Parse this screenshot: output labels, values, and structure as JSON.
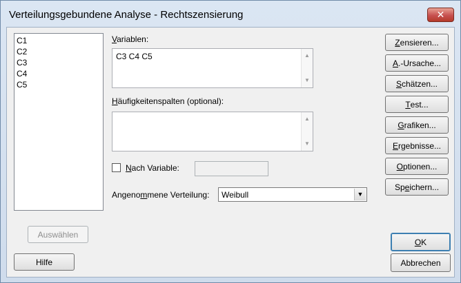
{
  "window": {
    "title": "Verteilungsgebundene Analyse - Rechtszensierung",
    "close_icon": "close-icon"
  },
  "columns_list": {
    "items": [
      "C1",
      "C2",
      "C3",
      "C4",
      "C5"
    ]
  },
  "variables": {
    "label_pre": "",
    "label_u": "V",
    "label_post": "ariablen:",
    "value": "C3 C4 C5"
  },
  "frequency": {
    "label_pre": "",
    "label_u": "H",
    "label_post": "äufigkeitenspalten (optional):",
    "value": ""
  },
  "by_variable": {
    "label_pre": "",
    "label_u": "N",
    "label_post": "ach Variable:",
    "checked": false,
    "value": ""
  },
  "distribution": {
    "label_pre": "Angeno",
    "label_u": "m",
    "label_post": "mene Verteilung:",
    "selected": "Weibull"
  },
  "buttons": {
    "select": "Auswählen",
    "help": "Hilfe",
    "ok_u": "O",
    "ok_post": "K",
    "cancel": "Abbrechen",
    "censor_u": "Z",
    "censor_post": "ensieren...",
    "cause_u": "A",
    "cause_post": ".-Ursache...",
    "estimate_u": "S",
    "estimate_post": "chätzen...",
    "test_pre": "",
    "test_u": "T",
    "test_post": "est...",
    "graphs_u": "G",
    "graphs_post": "rafiken...",
    "results_u": "E",
    "results_post": "rgebnisse...",
    "options_u": "O",
    "options_post": "ptionen...",
    "store_pre": "Sp",
    "store_u": "e",
    "store_post": "ichern..."
  }
}
